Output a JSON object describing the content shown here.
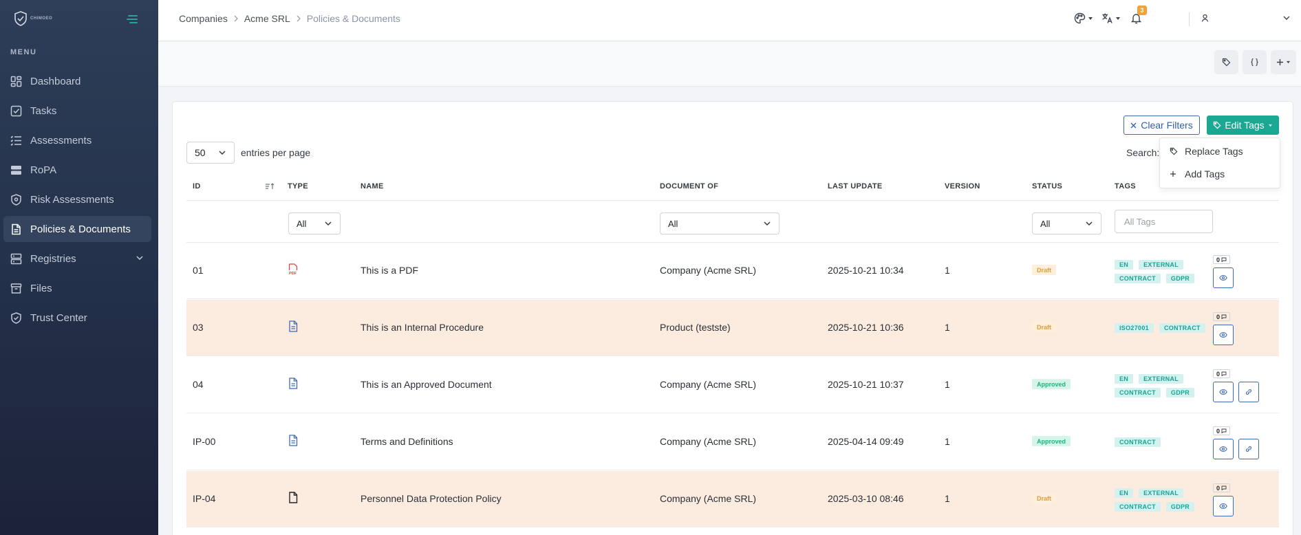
{
  "app": {
    "logo_text": "CHIMOEO"
  },
  "sidebar": {
    "menu_title": "MENU",
    "items": [
      {
        "label": "Dashboard",
        "icon": "dashboard-icon"
      },
      {
        "label": "Tasks",
        "icon": "tasks-icon"
      },
      {
        "label": "Assessments",
        "icon": "assessments-icon"
      },
      {
        "label": "RoPA",
        "icon": "ropa-icon"
      },
      {
        "label": "Risk Assessments",
        "icon": "shield-icon"
      },
      {
        "label": "Policies & Documents",
        "icon": "document-icon",
        "active": true
      },
      {
        "label": "Registries",
        "icon": "registries-icon"
      },
      {
        "label": "Files",
        "icon": "archive-icon"
      },
      {
        "label": "Trust Center",
        "icon": "trust-shield-icon"
      }
    ]
  },
  "header": {
    "breadcrumb": [
      "Companies",
      "Acme SRL",
      "Policies & Documents"
    ],
    "notifications_count": "3"
  },
  "toolbar": {
    "clear_filters": "Clear Filters",
    "edit_tags": "Edit Tags",
    "dropdown": {
      "replace_tags": "Replace Tags",
      "add_tags": "Add Tags"
    }
  },
  "table_controls": {
    "entries_value": "50",
    "entries_label": "entries per page",
    "search_label": "Search:"
  },
  "table": {
    "columns": [
      "ID",
      "TYPE",
      "NAME",
      "DOCUMENT OF",
      "LAST UPDATE",
      "VERSION",
      "STATUS",
      "TAGS"
    ],
    "filters": {
      "type": "All",
      "document_of": "All",
      "status": "All",
      "tags_placeholder": "All Tags"
    },
    "rows": [
      {
        "id": "01",
        "type": "pdf-icon",
        "name": "This is a PDF",
        "document_of": "Company (Acme SRL)",
        "last_update": "2025-10-21 10:34",
        "version": "1",
        "status": "Draft",
        "tags": [
          "EN",
          "EXTERNAL",
          "CONTRACT",
          "GDPR"
        ],
        "comments": "0"
      },
      {
        "id": "03",
        "type": "document-file-icon",
        "name": "This is an Internal Procedure",
        "document_of": "Product (testste)",
        "last_update": "2025-10-21 10:36",
        "version": "1",
        "status": "Draft",
        "tags": [
          "ISO27001",
          "CONTRACT"
        ],
        "comments": "0"
      },
      {
        "id": "04",
        "type": "document-file-icon",
        "name": "This is an Approved Document",
        "document_of": "Company (Acme SRL)",
        "last_update": "2025-10-21 10:37",
        "version": "1",
        "status": "Approved",
        "tags": [
          "EN",
          "EXTERNAL",
          "CONTRACT",
          "GDPR"
        ],
        "comments": "0"
      },
      {
        "id": "IP-00",
        "type": "document-file-icon",
        "name": "Terms and Definitions",
        "document_of": "Company (Acme SRL)",
        "last_update": "2025-04-14 09:49",
        "version": "1",
        "status": "Approved",
        "tags": [
          "CONTRACT"
        ],
        "comments": "0"
      },
      {
        "id": "IP-04",
        "type": "blank-file-icon",
        "name": "Personnel Data Protection Policy",
        "document_of": "Company (Acme SRL)",
        "last_update": "2025-03-10 08:46",
        "version": "1",
        "status": "Draft",
        "tags": [
          "EN",
          "EXTERNAL",
          "CONTRACT",
          "GDPR"
        ],
        "comments": "0"
      }
    ]
  },
  "colors": {
    "accent": "#1aa892",
    "primary_outline": "#3e6ab0",
    "draft": "#e49c39",
    "approved": "#1eb47c",
    "row_highlight": "#fcece0"
  }
}
